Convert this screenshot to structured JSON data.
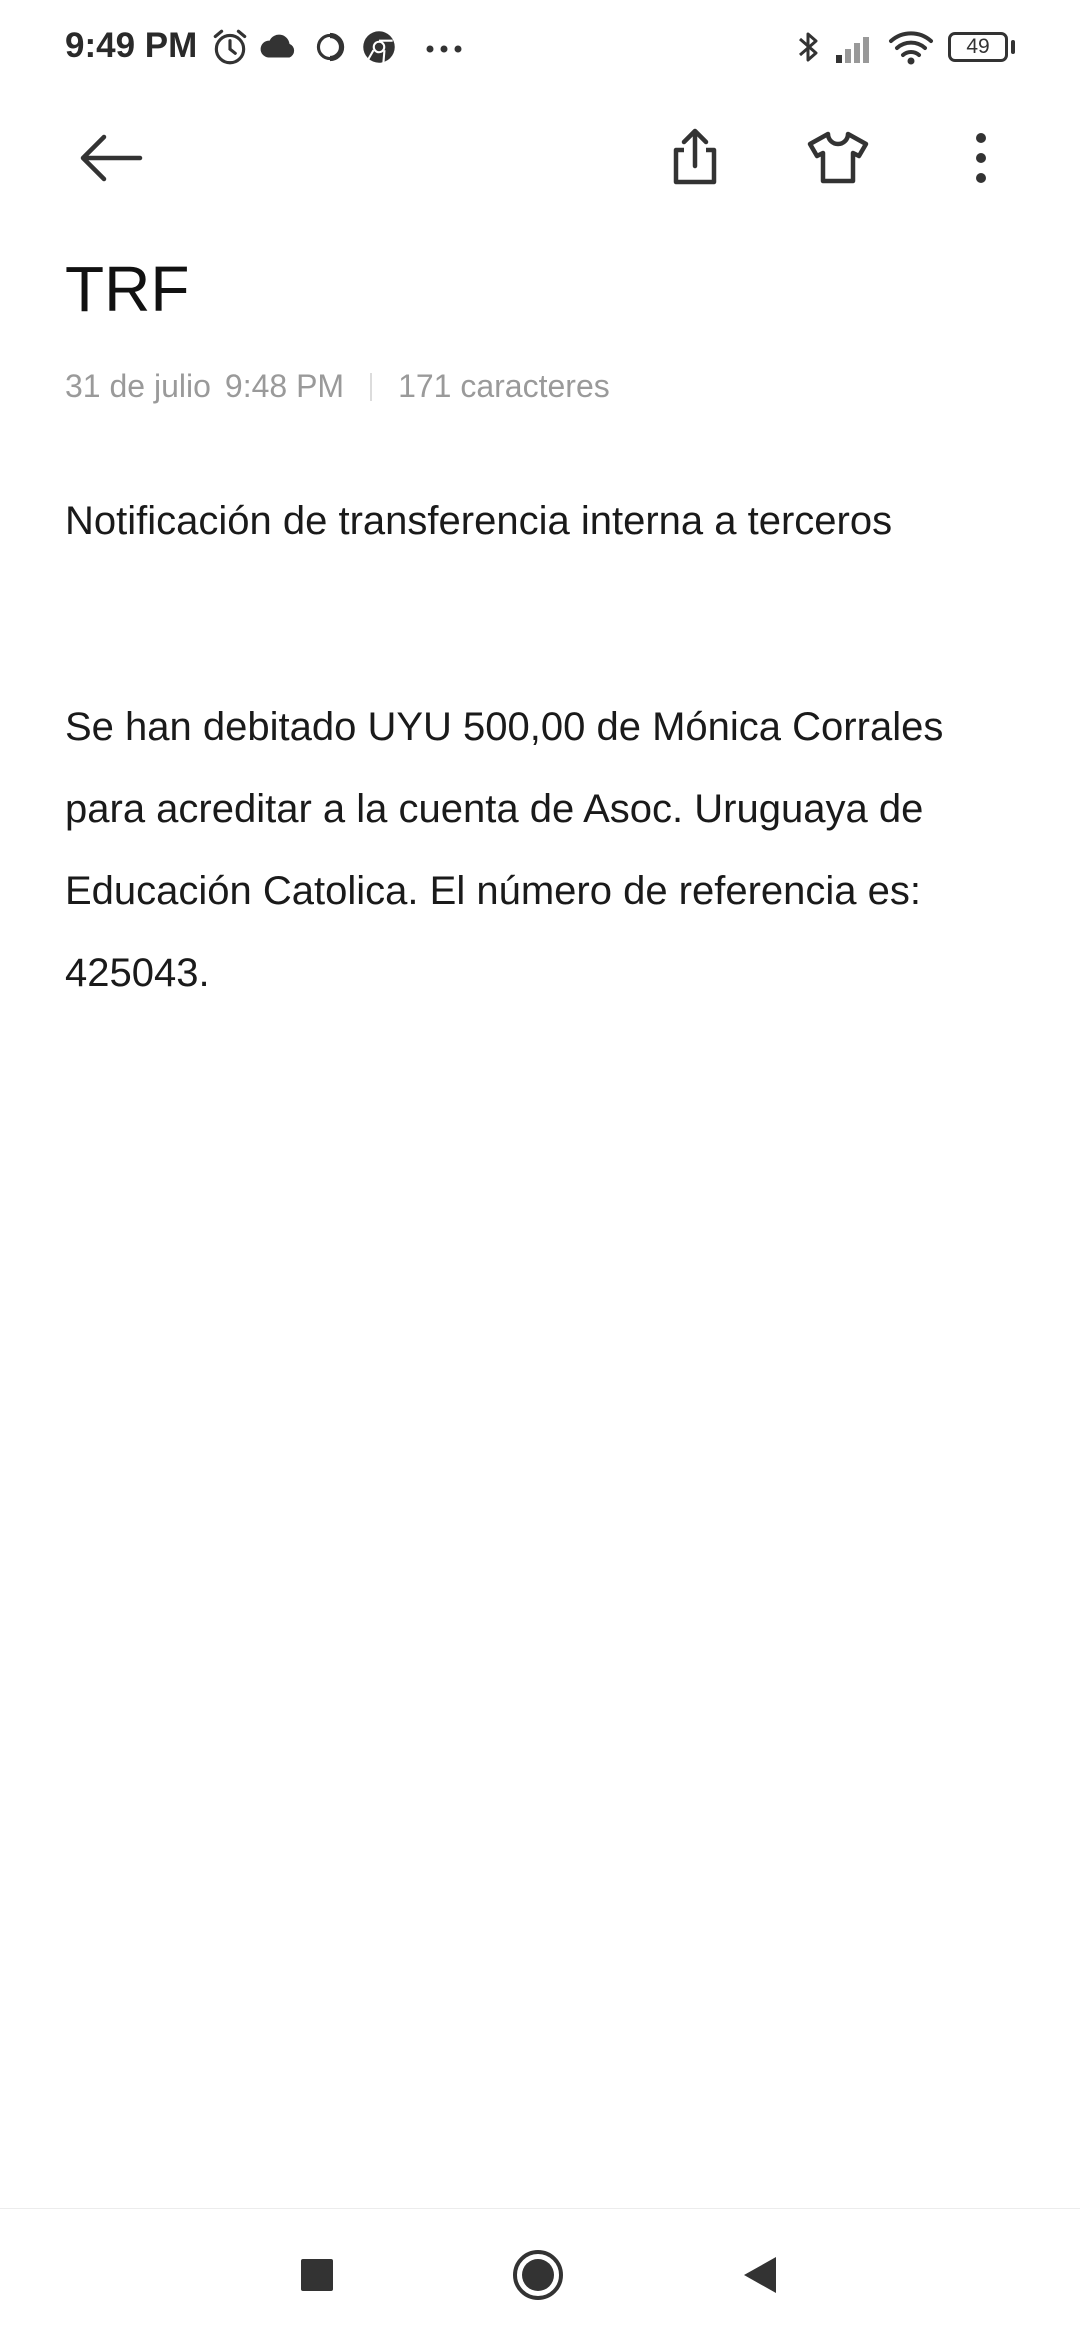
{
  "status_bar": {
    "time": "9:49 PM",
    "battery": "49",
    "icons": [
      "alarm-icon",
      "cloud-icon",
      "sync-circle-icon",
      "chrome-icon",
      "more-dots-icon",
      "bluetooth-icon",
      "signal-icon",
      "wifi-icon",
      "battery-icon"
    ]
  },
  "toolbar": {
    "back_icon": "arrow-left-icon",
    "share_icon": "share-icon",
    "theme_icon": "tshirt-icon",
    "menu_icon": "more-vertical-icon"
  },
  "note": {
    "title": "TRF",
    "date": "31 de julio",
    "time": "9:48 PM",
    "char_count": "171 caracteres",
    "paragraphs": [
      "Notificación de transferencia interna a terceros",
      "Se han debitado UYU 500,00 de Mónica Corrales para acreditar a la cuenta de Asoc. Uruguaya de Educación Catolica. El número de referencia es: 425043."
    ]
  },
  "nav_bar": {
    "icons": [
      "recents-square-icon",
      "home-circle-icon",
      "back-triangle-icon"
    ]
  },
  "colors": {
    "text": "#1a1a1a",
    "meta_text": "#9a9a9a",
    "background": "#ffffff"
  }
}
